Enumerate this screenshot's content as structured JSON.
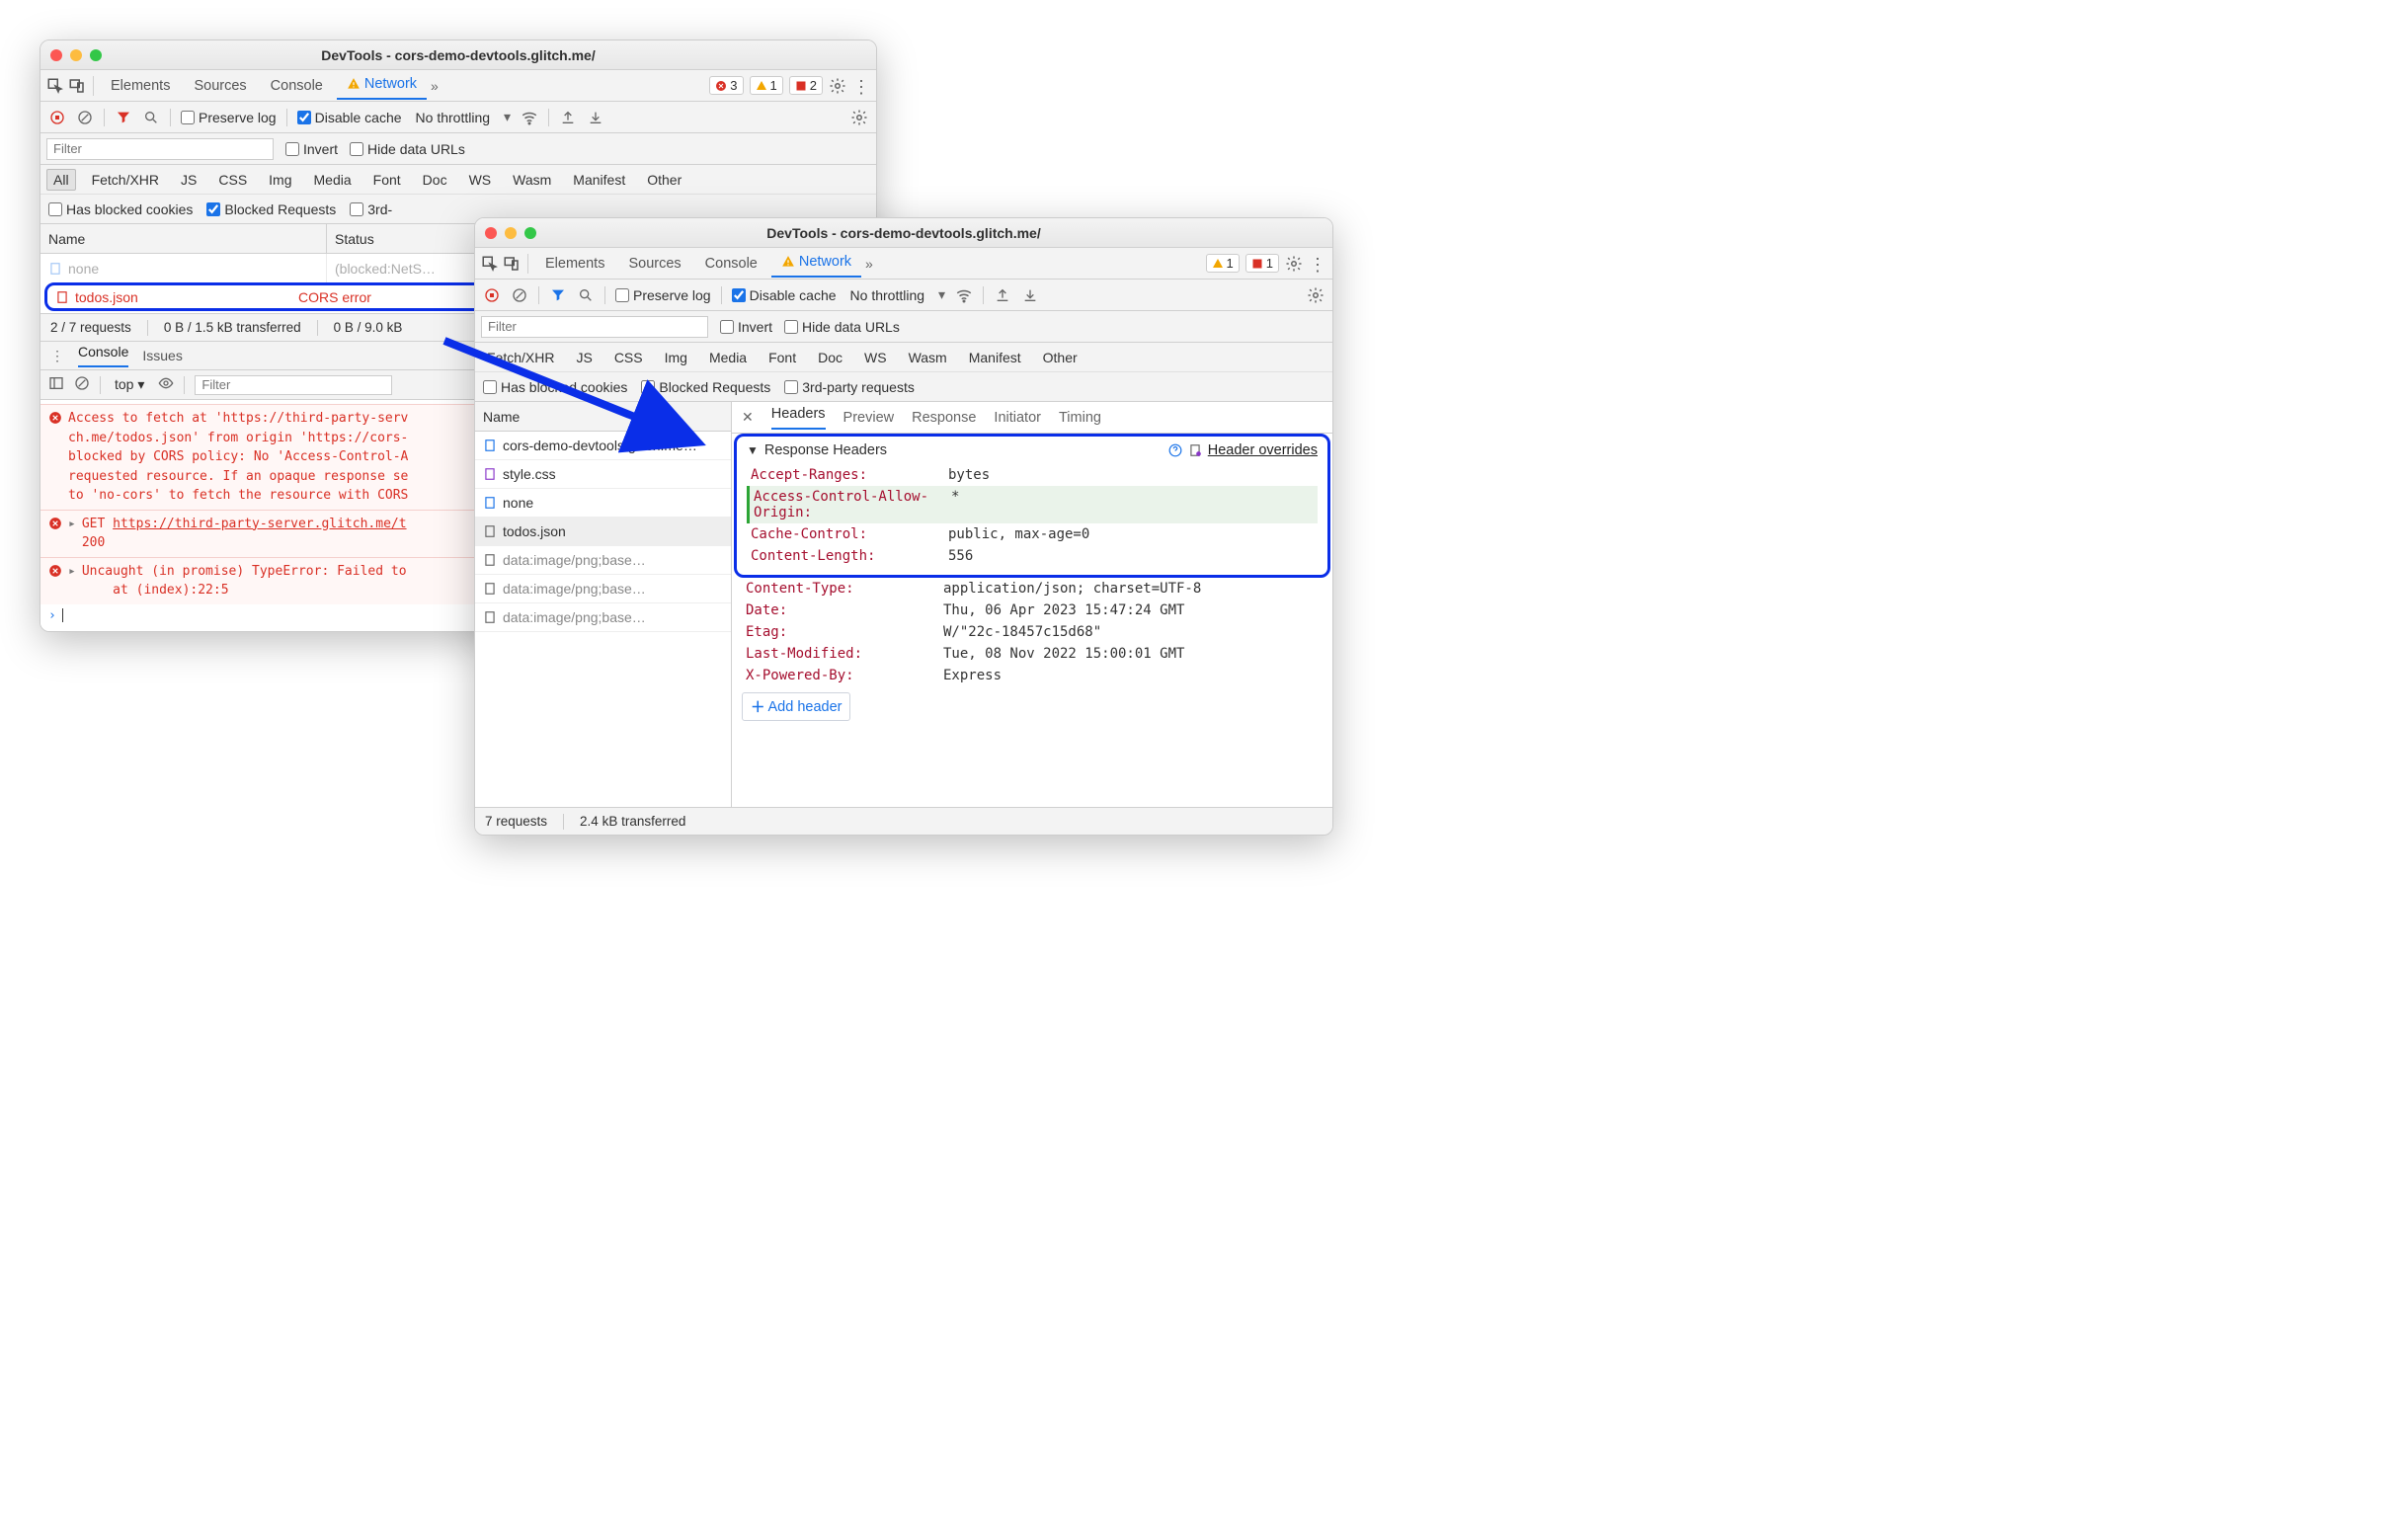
{
  "window1": {
    "title": "DevTools - cors-demo-devtools.glitch.me/",
    "tabs": [
      "Elements",
      "Sources",
      "Console",
      "Network"
    ],
    "activeTab": "Network",
    "issues": {
      "errors": "3",
      "warnings": "1",
      "blocked": "2"
    },
    "toolbar": {
      "preserve_log": "Preserve log",
      "disable_cache": "Disable cache",
      "throttling": "No throttling"
    },
    "filter": {
      "placeholder": "Filter",
      "invert": "Invert",
      "hide_data_urls": "Hide data URLs"
    },
    "filter_types": [
      "All",
      "Fetch/XHR",
      "JS",
      "CSS",
      "Img",
      "Media",
      "Font",
      "Doc",
      "WS",
      "Wasm",
      "Manifest",
      "Other"
    ],
    "checks": {
      "blocked_cookies": "Has blocked cookies",
      "blocked_requests": "Blocked Requests",
      "third_party_prefix": "3rd-"
    },
    "columns": {
      "name": "Name",
      "status": "Status"
    },
    "rows": {
      "none_name": "none",
      "none_status": "(blocked:NetS…",
      "todos_name": "todos.json",
      "todos_status": "CORS error"
    },
    "status": {
      "requests": "2 / 7 requests",
      "transferred": "0 B / 1.5 kB transferred",
      "resources": "0 B / 9.0 kB"
    },
    "drawer_tabs": {
      "console": "Console",
      "issues": "Issues"
    },
    "console_toolbar": {
      "scope": "top",
      "filter_placeholder": "Filter"
    },
    "console": {
      "msg1": "Access to fetch at 'https://third-party-serv\nch.me/todos.json' from origin 'https://cors-\nblocked by CORS policy: No 'Access-Control-A\nrequested resource. If an opaque response se\nto 'no-cors' to fetch the resource with CORS",
      "msg2_prefix": "GET ",
      "msg2_link": "https://third-party-server.glitch.me/t",
      "msg2_suffix": "\n200",
      "msg3": "Uncaught (in promise) TypeError: Failed to\n    at (index):22:5"
    }
  },
  "window2": {
    "title": "DevTools - cors-demo-devtools.glitch.me/",
    "tabs": [
      "Elements",
      "Sources",
      "Console",
      "Network"
    ],
    "activeTab": "Network",
    "issues": {
      "warnings": "1",
      "blocked": "1"
    },
    "toolbar": {
      "preserve_log": "Preserve log",
      "disable_cache": "Disable cache",
      "throttling": "No throttling"
    },
    "filter": {
      "placeholder": "Filter",
      "invert": "Invert",
      "hide_data_urls": "Hide data URLs"
    },
    "filter_types": [
      "Fetch/XHR",
      "JS",
      "CSS",
      "Img",
      "Media",
      "Font",
      "Doc",
      "WS",
      "Wasm",
      "Manifest",
      "Other"
    ],
    "checks": {
      "blocked_cookies": "Has blocked cookies",
      "blocked_requests": "Blocked Requests",
      "third_party": "3rd-party requests"
    },
    "columns": {
      "name": "Name"
    },
    "rows": [
      "cors-demo-devtools.glitch.me…",
      "style.css",
      "none",
      "todos.json",
      "data:image/png;base…",
      "data:image/png;base…",
      "data:image/png;base…"
    ],
    "detail_tabs": [
      "Headers",
      "Preview",
      "Response",
      "Initiator",
      "Timing"
    ],
    "response_headers_title": "Response Headers",
    "header_overrides_label": "Header overrides",
    "headers": [
      {
        "k": "Accept-Ranges:",
        "v": "bytes"
      },
      {
        "k": "Access-Control-Allow-Origin:",
        "v": "*",
        "added": true
      },
      {
        "k": "Cache-Control:",
        "v": "public, max-age=0"
      },
      {
        "k": "Content-Length:",
        "v": "556"
      },
      {
        "k": "Content-Type:",
        "v": "application/json; charset=UTF-8"
      },
      {
        "k": "Date:",
        "v": "Thu, 06 Apr 2023 15:47:24 GMT"
      },
      {
        "k": "Etag:",
        "v": "W/\"22c-18457c15d68\""
      },
      {
        "k": "Last-Modified:",
        "v": "Tue, 08 Nov 2022 15:00:01 GMT"
      },
      {
        "k": "X-Powered-By:",
        "v": "Express"
      }
    ],
    "add_header_label": "Add header",
    "status": {
      "requests": "7 requests",
      "transferred": "2.4 kB transferred"
    }
  }
}
